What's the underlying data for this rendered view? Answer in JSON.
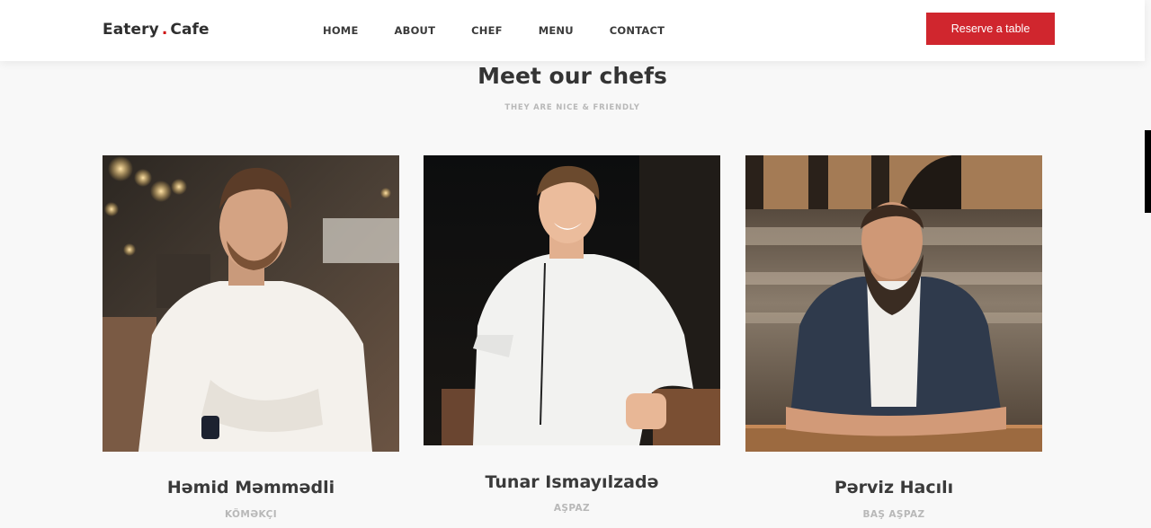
{
  "header": {
    "logo_main": "Eatery",
    "logo_dot": ".",
    "logo_sub": "Cafe",
    "nav": [
      "HOME",
      "ABOUT",
      "CHEF",
      "MENU",
      "CONTACT"
    ],
    "cta": "Reserve a table"
  },
  "section": {
    "title": "Meet our chefs",
    "subtitle": "THEY ARE NICE & FRIENDLY"
  },
  "chefs": [
    {
      "name": "Həmid Məmmədli",
      "role": "KÖMƏKÇI"
    },
    {
      "name": "Tunar Ismayılzadə",
      "role": "AŞPAZ"
    },
    {
      "name": "Pərviz Hacılı",
      "role": "BAŞ AŞPAZ"
    }
  ],
  "colors": {
    "accent": "#d0262e",
    "heading": "#343434",
    "muted": "#b8b8b8"
  }
}
